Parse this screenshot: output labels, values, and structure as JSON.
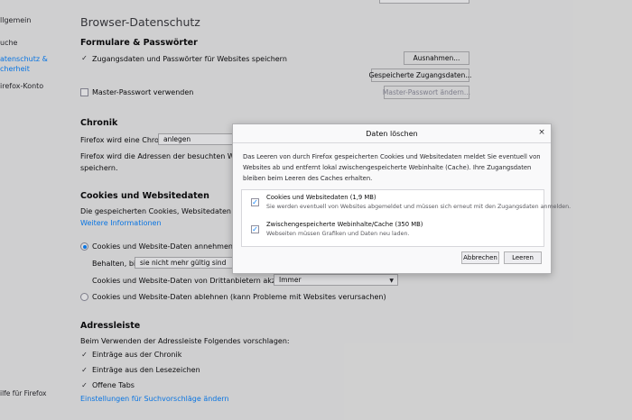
{
  "sidebar": {
    "items": [
      {
        "label": "llgemein",
        "active": false
      },
      {
        "label": "uche",
        "active": false
      },
      {
        "label": "atenschutz &",
        "active": true
      },
      {
        "label": "cherheit",
        "active": true
      },
      {
        "label": "irefox-Konto",
        "active": false
      }
    ],
    "footer": "ilfe für Firefox"
  },
  "header": {
    "title": "Browser-Datenschutz"
  },
  "forms": {
    "heading": "Formulare & Passwörter",
    "save_logins": {
      "label": "Zugangsdaten und Passwörter für Websites speichern",
      "checked": true
    },
    "exceptions_button": "Ausnahmen...",
    "saved_logins_button": "Gespeicherte Zugangsdaten...",
    "master_password": {
      "label": "Master-Passwort verwenden",
      "checked": false
    },
    "change_master_button": "Master-Passwort ändern..."
  },
  "history": {
    "heading": "Chronik",
    "mode_label": "Firefox wird eine Chronik",
    "mode_value": "anlegen",
    "desc": "Firefox wird die Adressen der besuchten Webseiten",
    "desc2": "speichern."
  },
  "cookies": {
    "heading": "Cookies und Websitedaten",
    "desc": "Die gespeicherten Cookies, Websitedaten und der",
    "more_info": "Weitere Informationen",
    "accept": {
      "label": "Cookies und Website-Daten annehmen (empfo",
      "selected": true
    },
    "keep_label": "Behalten, bis",
    "keep_value": "sie nicht mehr gültig sind",
    "third_party_label": "Cookies und Website-Daten von Drittanbietern akzeptieren",
    "third_party_value": "Immer",
    "block": {
      "label": "Cookies und Website-Daten ablehnen (kann Probleme mit Websites verursachen)",
      "selected": false
    }
  },
  "addressbar": {
    "heading": "Adressleiste",
    "desc": "Beim Verwenden der Adressleiste Folgendes vorschlagen:",
    "options": [
      {
        "label": "Einträge aus der Chronik",
        "checked": true
      },
      {
        "label": "Einträge aus den Lesezeichen",
        "checked": true
      },
      {
        "label": "Offene Tabs",
        "checked": true
      }
    ],
    "settings_link": "Einstellungen für Suchvorschläge ändern"
  },
  "dialog": {
    "title": "Daten löschen",
    "close_icon": "×",
    "description": "Das Leeren von durch Firefox gespeicherten Cookies und Websitedaten meldet Sie eventuell von Websites ab und entfernt lokal zwischengespeicherte Webinhalte (Cache). Ihre Zugangsdaten bleiben beim Leeren des Caches erhalten.",
    "options": [
      {
        "title": "Cookies und Websitedaten (1,9 MB)",
        "subtitle": "Sie werden eventuell von Websites abgemeldet und müssen sich erneut mit den Zugangsdaten anmelden.",
        "checked": true
      },
      {
        "title": "Zwischengespeicherte Webinhalte/Cache (350 MB)",
        "subtitle": "Webseiten müssen Grafiken und Daten neu laden.",
        "checked": true
      }
    ],
    "cancel_button": "Abbrechen",
    "clear_button": "Leeren"
  },
  "colors": {
    "accent": "#0a84ff",
    "background": "#ebebeb",
    "dialog": "#f9f9fa"
  },
  "icons": {
    "check": "check-icon",
    "close": "close-icon",
    "dropdown": "chevron-down-icon"
  }
}
